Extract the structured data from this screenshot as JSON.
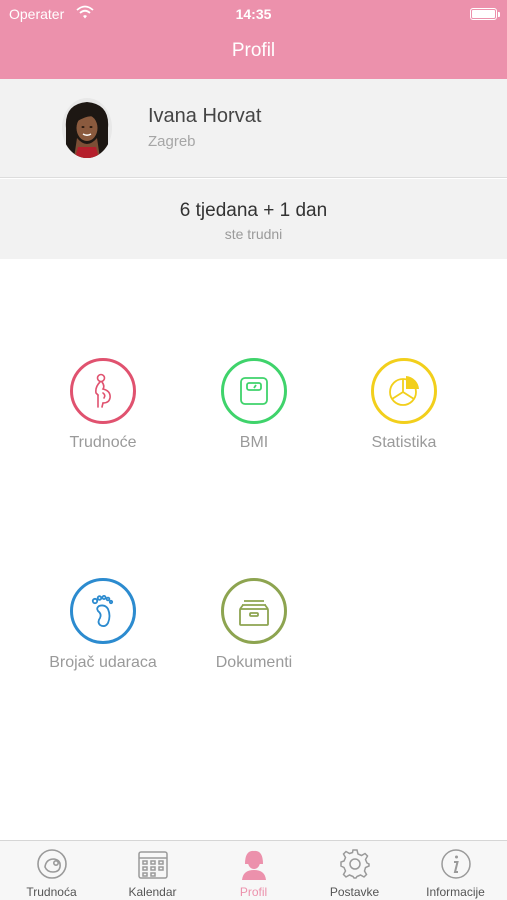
{
  "status_bar": {
    "carrier": "Operater",
    "time": "14:35",
    "wifi_icon": "wifi-icon",
    "battery_icon": "battery-icon"
  },
  "header": {
    "title": "Profil"
  },
  "profile": {
    "name": "Ivana Horvat",
    "city": "Zagreb",
    "avatar_icon": "avatar-photo"
  },
  "pregnancy": {
    "duration": "6 tjedana + 1 dan",
    "subtitle": "ste trudni"
  },
  "tiles": [
    {
      "label": "Trudnoće",
      "icon": "pregnant-woman-icon",
      "color": "#e0526f"
    },
    {
      "label": "BMI",
      "icon": "scale-icon",
      "color": "#3fd36b"
    },
    {
      "label": "Statistika",
      "icon": "pie-chart-icon",
      "color": "#f2cf1c"
    },
    {
      "label": "Brojač udaraca",
      "icon": "footprint-icon",
      "color": "#2c8bcf"
    },
    {
      "label": "Dokumenti",
      "icon": "archive-box-icon",
      "color": "#8da450"
    }
  ],
  "tabbar": {
    "active_color": "#ec91ac",
    "items": [
      {
        "label": "Trudnoća",
        "icon": "pregnancy-tab-icon"
      },
      {
        "label": "Kalendar",
        "icon": "calendar-icon"
      },
      {
        "label": "Profil",
        "icon": "profile-icon",
        "active": true
      },
      {
        "label": "Postavke",
        "icon": "settings-gear-icon"
      },
      {
        "label": "Informacije",
        "icon": "info-icon"
      }
    ]
  }
}
